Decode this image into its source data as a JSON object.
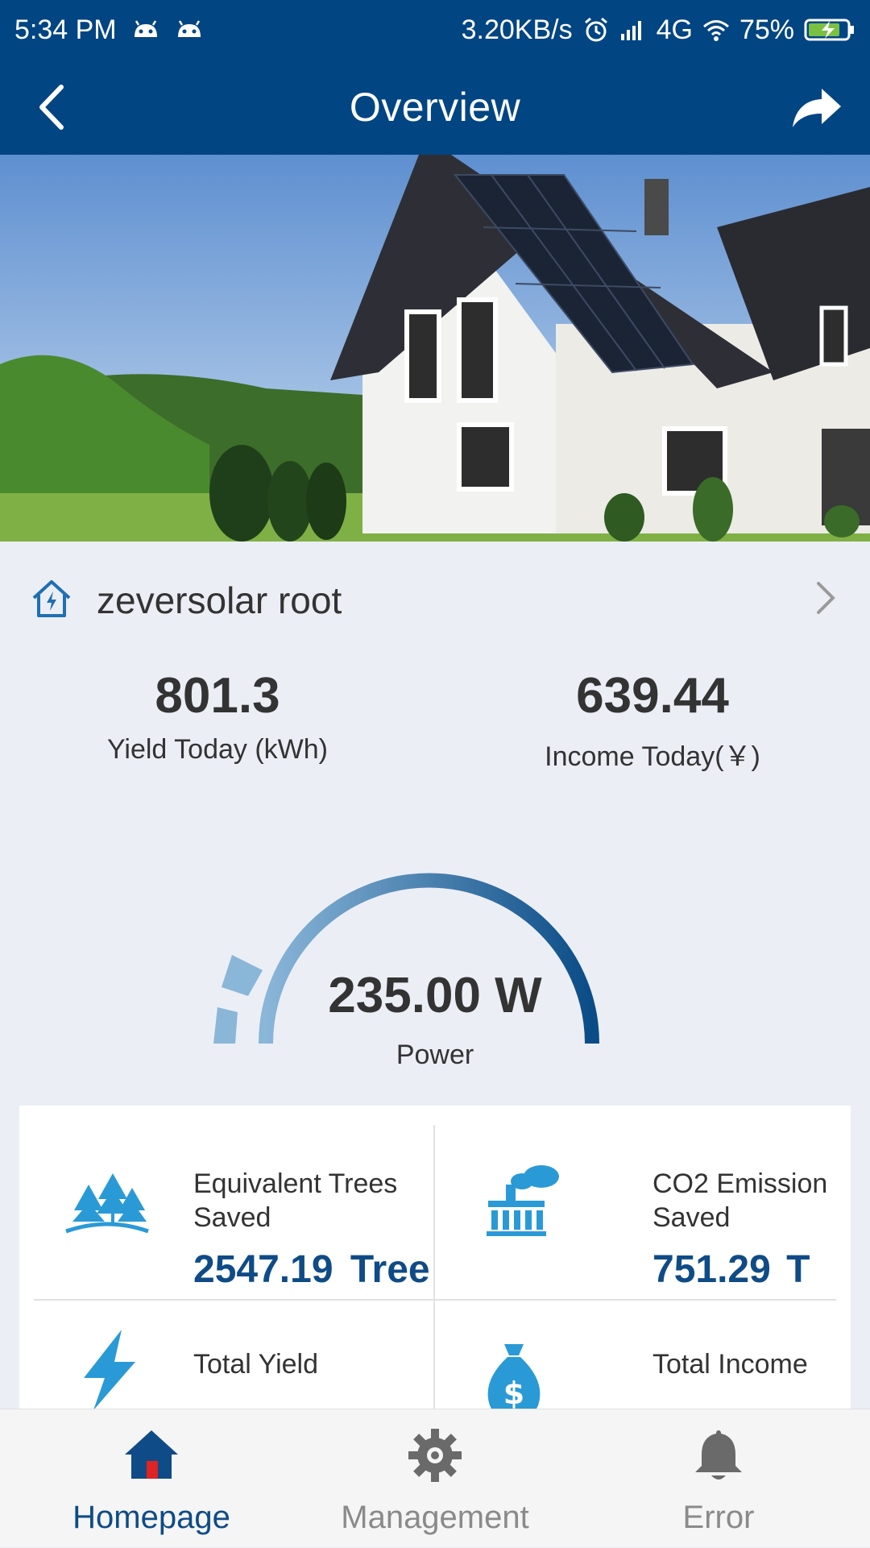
{
  "status_bar": {
    "time": "5:34 PM",
    "network_speed": "3.20KB/s",
    "network_type": "4G",
    "battery": "75%"
  },
  "app_bar": {
    "title": "Overview",
    "back_icon": "chevron-left-icon",
    "share_icon": "share-arrow-icon"
  },
  "plant": {
    "name": "zeversolar root",
    "icon": "home-power-icon"
  },
  "today": {
    "yield_value": "801.3",
    "yield_label": "Yield Today (kWh)",
    "income_value": "639.44",
    "income_label": "Income Today(￥)"
  },
  "power": {
    "value": "235.00 W",
    "label": "Power"
  },
  "metrics": [
    {
      "label_line1": "Equivalent Trees",
      "label_line2": "Saved",
      "value": "2547.19",
      "unit": "Tree",
      "icon": "trees-icon"
    },
    {
      "label_line1": "CO2 Emission",
      "label_line2": "Saved",
      "value": "751.29",
      "unit": "T",
      "icon": "factory-icon"
    },
    {
      "label_line1": "Total Yield",
      "label_line2": "",
      "value": "",
      "unit": "",
      "icon": "lightning-icon"
    },
    {
      "label_line1": "Total Income",
      "label_line2": "",
      "value": "",
      "unit": "",
      "icon": "money-bag-icon"
    }
  ],
  "nav": [
    {
      "label": "Homepage",
      "icon": "home-icon",
      "active": true
    },
    {
      "label": "Management",
      "icon": "gear-icon",
      "active": false
    },
    {
      "label": "Error",
      "icon": "bell-icon",
      "active": false
    }
  ],
  "colors": {
    "primary": "#024583",
    "accent": "#0f4b86",
    "icon_blue": "#2a9ad6",
    "background": "#eceef6"
  }
}
